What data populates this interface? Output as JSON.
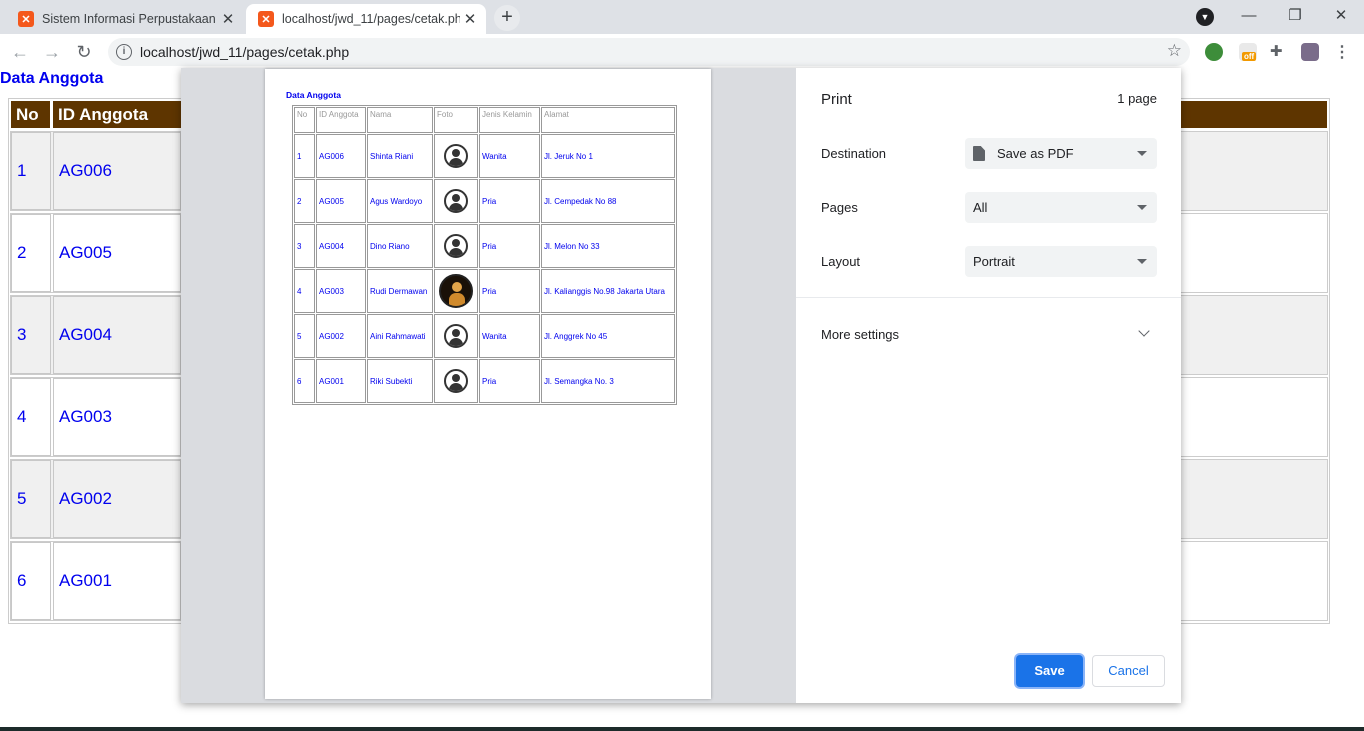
{
  "browser": {
    "tabs": [
      {
        "title": "Sistem Informasi Perpustakaan",
        "active": false
      },
      {
        "title": "localhost/jwd_11/pages/cetak.ph",
        "active": true
      }
    ],
    "address": "localhost/jwd_11/pages/cetak.php",
    "extension_badge": "off"
  },
  "page": {
    "title": "Data Anggota",
    "columns": [
      "No",
      "ID Anggota"
    ],
    "rows": [
      {
        "no": "1",
        "id": "AG006"
      },
      {
        "no": "2",
        "id": "AG005"
      },
      {
        "no": "3",
        "id": "AG004"
      },
      {
        "no": "4",
        "id": "AG003"
      },
      {
        "no": "5",
        "id": "AG002"
      },
      {
        "no": "6",
        "id": "AG001"
      }
    ]
  },
  "preview": {
    "title": "Data Anggota",
    "columns": [
      "No",
      "ID Anggota",
      "Nama",
      "Foto",
      "Jenis Kelamin",
      "Alamat"
    ],
    "rows": [
      {
        "no": "1",
        "id": "AG006",
        "nama": "Shinta Riani",
        "jk": "Wanita",
        "alamat": "Jl. Jeruk No 1",
        "photo": false
      },
      {
        "no": "2",
        "id": "AG005",
        "nama": "Agus Wardoyo",
        "jk": "Pria",
        "alamat": "Jl. Cempedak No 88",
        "photo": false
      },
      {
        "no": "3",
        "id": "AG004",
        "nama": "Dino Riano",
        "jk": "Pria",
        "alamat": "Jl. Melon No 33",
        "photo": false
      },
      {
        "no": "4",
        "id": "AG003",
        "nama": "Rudi Dermawan",
        "jk": "Pria",
        "alamat": "Jl. Kalianggis No.98 Jakarta Utara",
        "photo": true
      },
      {
        "no": "5",
        "id": "AG002",
        "nama": "Aini Rahmawati",
        "jk": "Wanita",
        "alamat": "Jl. Anggrek No 45",
        "photo": false
      },
      {
        "no": "6",
        "id": "AG001",
        "nama": "Riki Subekti",
        "jk": "Pria",
        "alamat": "Jl. Semangka No. 3",
        "photo": false
      }
    ]
  },
  "print": {
    "title": "Print",
    "page_count": "1 page",
    "destination_label": "Destination",
    "destination_value": "Save as PDF",
    "pages_label": "Pages",
    "pages_value": "All",
    "layout_label": "Layout",
    "layout_value": "Portrait",
    "more_settings": "More settings",
    "save": "Save",
    "cancel": "Cancel"
  }
}
